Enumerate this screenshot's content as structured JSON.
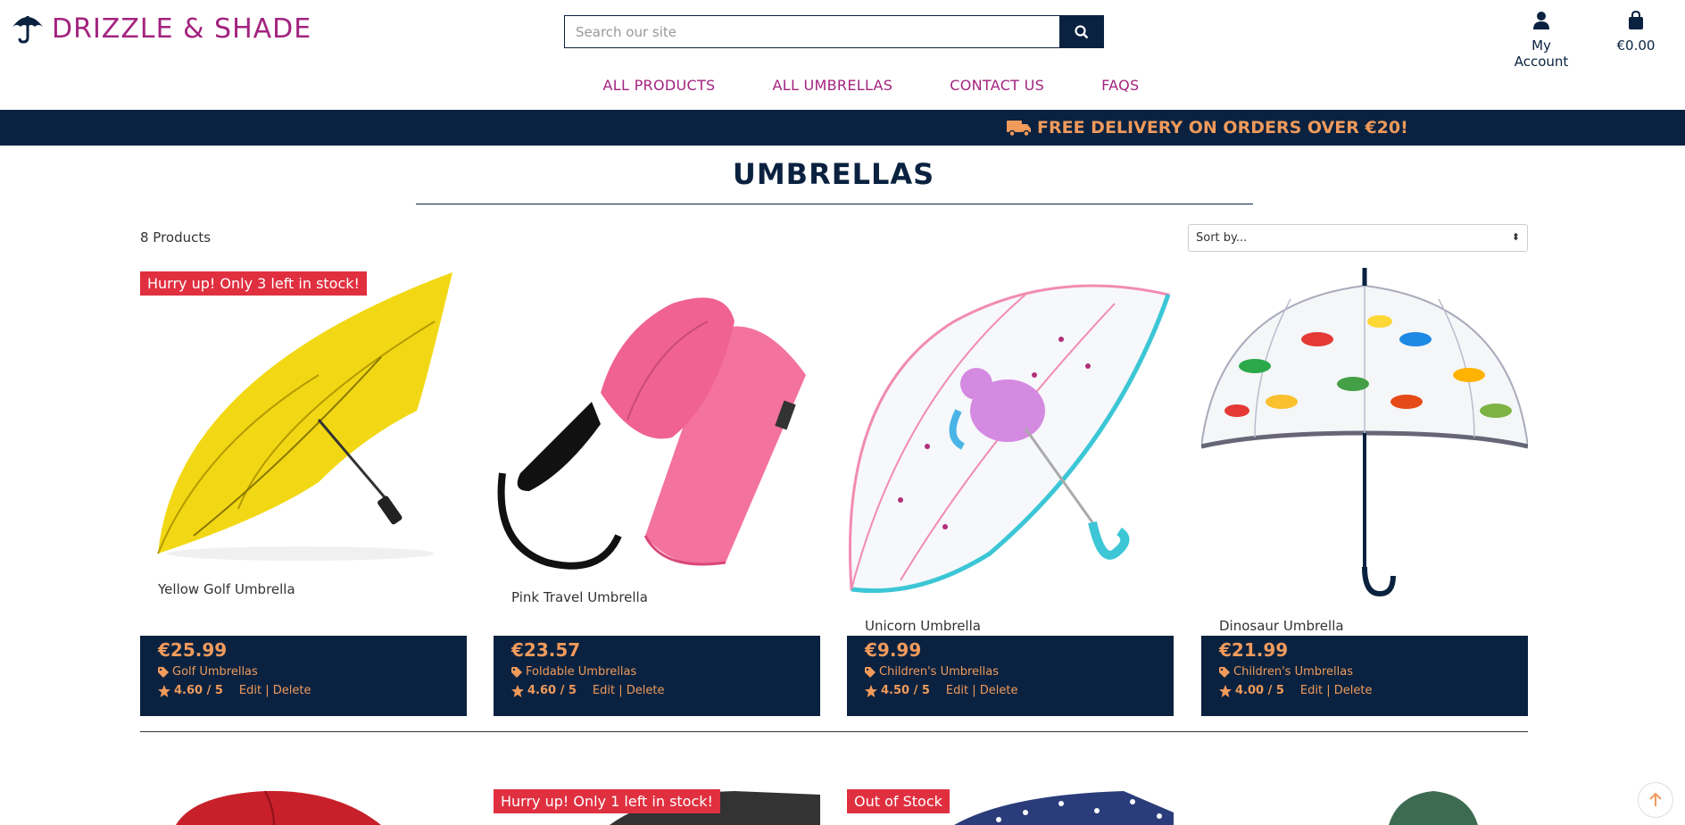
{
  "brand": {
    "name": "DRIZZLE & SHADE"
  },
  "search": {
    "placeholder": "Search our site"
  },
  "account": {
    "label": "My Account"
  },
  "bag": {
    "total": "€0.00"
  },
  "nav": [
    "ALL PRODUCTS",
    "ALL UMBRELLAS",
    "CONTACT US",
    "FAQS"
  ],
  "banner": {
    "text": "FREE DELIVERY ON ORDERS OVER €20!"
  },
  "page": {
    "title": "UMBRELLAS",
    "count": "8 Products",
    "sort_placeholder": "Sort by..."
  },
  "products": [
    {
      "name": "Yellow Golf Umbrella",
      "price": "€25.99",
      "category": "Golf Umbrellas",
      "rating": "4.60 / 5",
      "badge": "Hurry up! Only 3 left in stock!"
    },
    {
      "name": "Pink Travel Umbrella",
      "price": "€23.57",
      "category": "Foldable Umbrellas",
      "rating": "4.60 / 5",
      "badge": ""
    },
    {
      "name": "Unicorn Umbrella",
      "price": "€9.99",
      "category": "Children's Umbrellas",
      "rating": "4.50 / 5",
      "badge": ""
    },
    {
      "name": "Dinosaur Umbrella",
      "price": "€21.99",
      "category": "Children's Umbrellas",
      "rating": "4.00 / 5",
      "badge": ""
    }
  ],
  "admin_links": {
    "edit": "Edit",
    "sep": "|",
    "delete": "Delete"
  },
  "row2_badges": [
    "Hurry up! Only 1 left in stock!",
    "Out of Stock"
  ],
  "colors": {
    "navy": "#0a2240",
    "magenta": "#a3237f",
    "orange": "#f09a5b",
    "badge_red": "#e03040"
  }
}
